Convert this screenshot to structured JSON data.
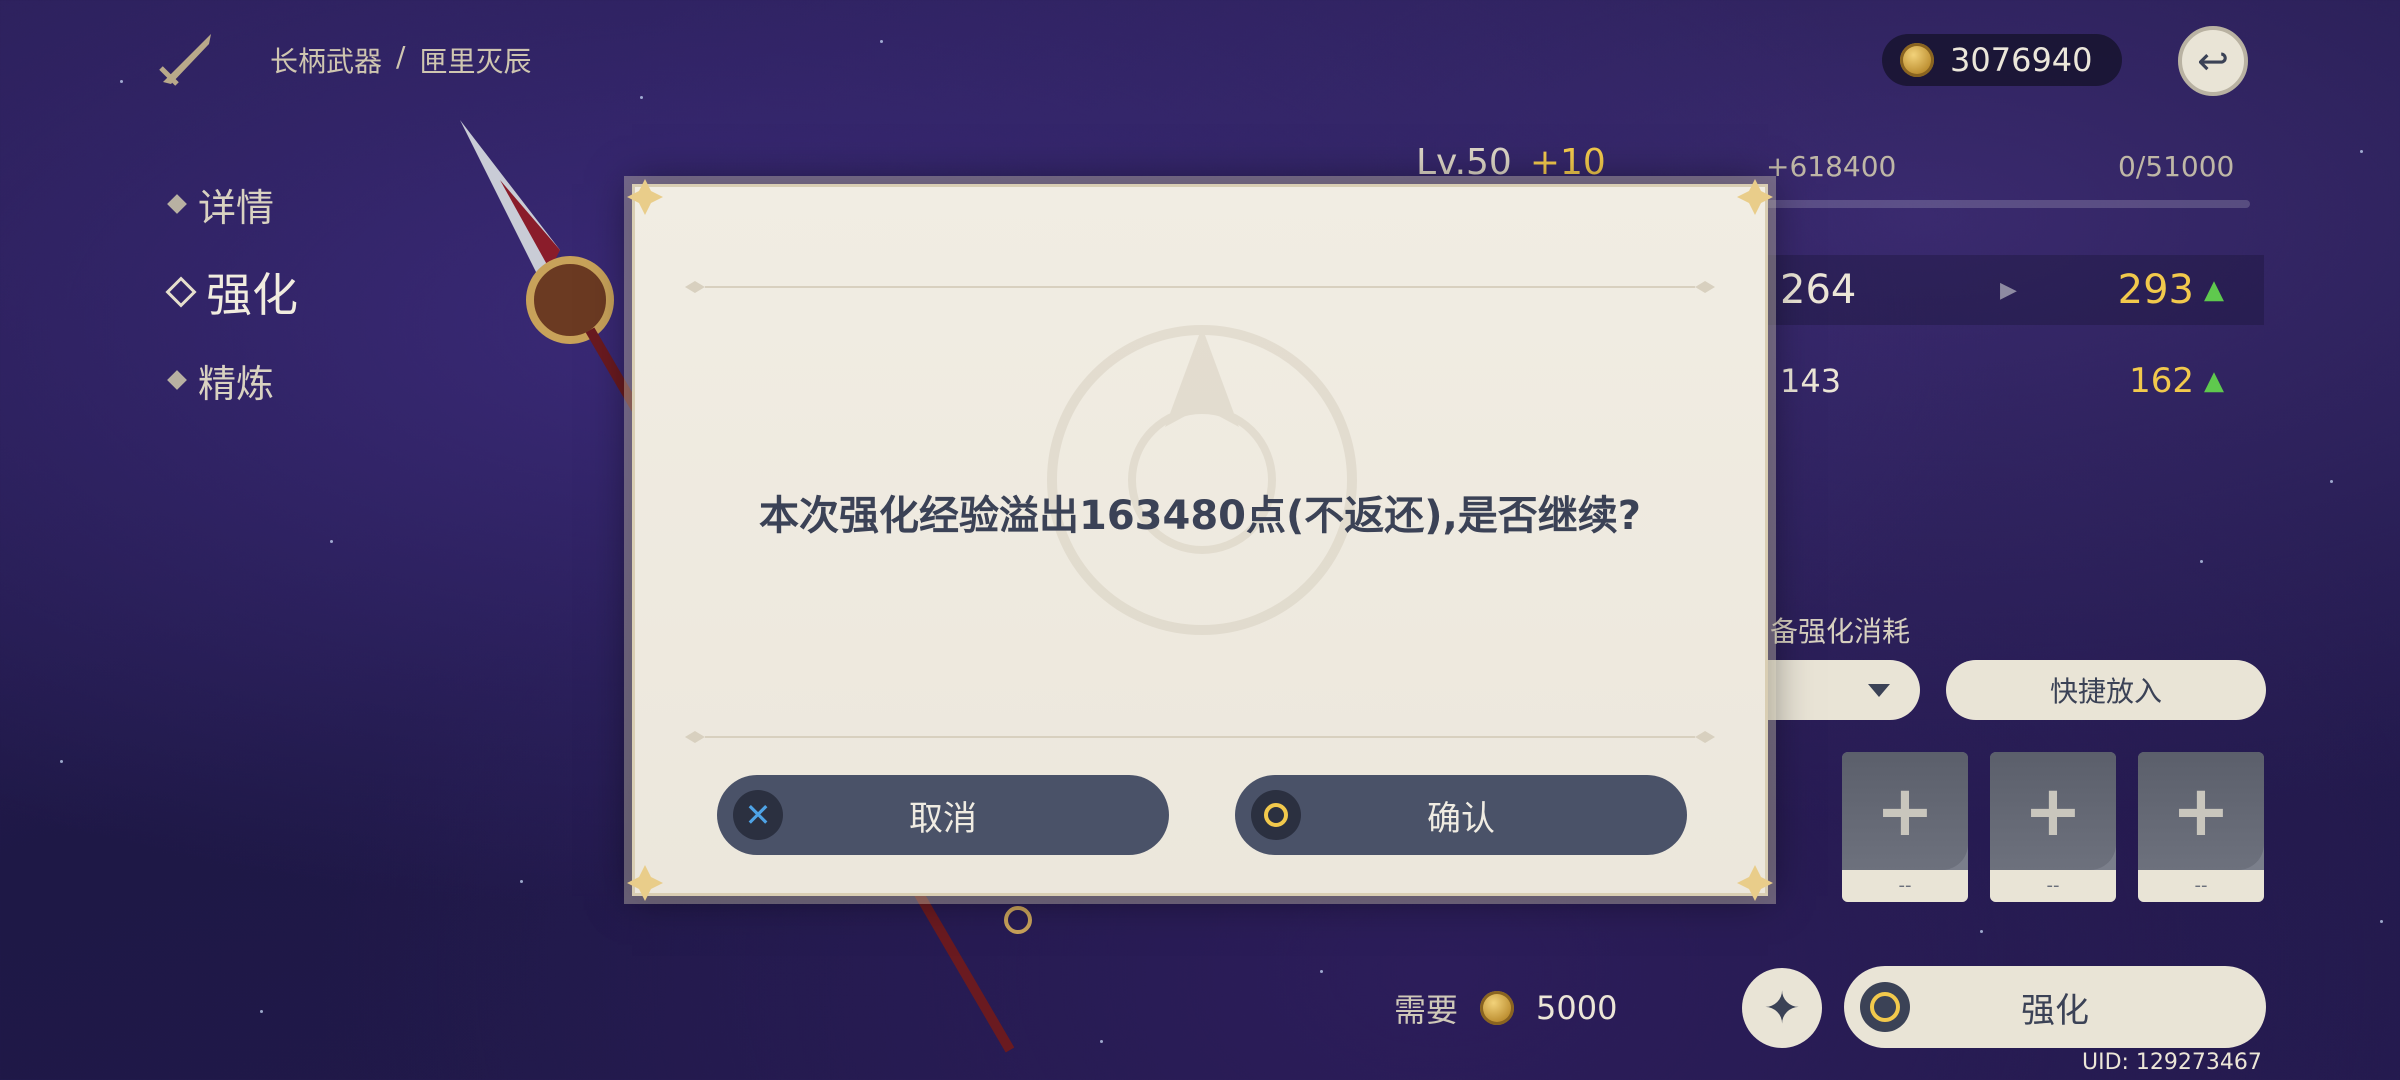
{
  "header": {
    "breadcrumb_category": "长柄武器",
    "breadcrumb_sep": "/",
    "breadcrumb_item": "匣里灭辰",
    "mora": "3076940"
  },
  "sidebar": {
    "items": [
      {
        "label": "详情",
        "active": false
      },
      {
        "label": "强化",
        "active": true
      },
      {
        "label": "精炼",
        "active": false
      }
    ]
  },
  "panel": {
    "level": "Lv.50",
    "level_add": "+10",
    "exp_add": "+618400",
    "exp_value": "0/51000",
    "exp_fill": 0,
    "stat1_from": "264",
    "stat1_to": "293",
    "stat2_from": "143",
    "stat2_to": "162",
    "materials_title": "备强化消耗",
    "quick_add": "快捷放入",
    "slot_counts": [
      "--",
      "--",
      "--"
    ],
    "need_label": "需要",
    "need_cost": "5000",
    "enhance_label": "强化",
    "uid": "UID: 129273467"
  },
  "modal": {
    "message": "本次强化经验溢出163480点(不返还),是否继续?",
    "cancel_label": "取消",
    "confirm_label": "确认"
  },
  "colors": {
    "accent_gold": "#f2c94c",
    "button_dark": "#4a5268",
    "up_green": "#5fc94e"
  }
}
